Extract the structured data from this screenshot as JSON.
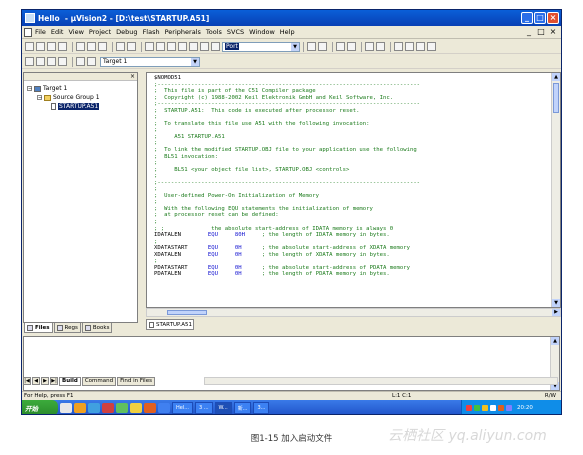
{
  "window": {
    "title": "Hello  - µVision2 - [D:\\test\\STARTUP.A51]",
    "buttons": {
      "minimize": "_",
      "maximize": "□",
      "close": "×"
    }
  },
  "menu": {
    "items": [
      "File",
      "Edit",
      "View",
      "Project",
      "Debug",
      "Flash",
      "Peripherals",
      "Tools",
      "SVCS",
      "Window",
      "Help"
    ],
    "mdi_buttons": [
      "_",
      "□",
      "×"
    ]
  },
  "toolbar1": {
    "find_value": "Port"
  },
  "toolbar2": {
    "target_combo": "Target 1"
  },
  "project": {
    "tree": {
      "target": "Target 1",
      "group": "Source Group 1",
      "file": "STARTUP.A51"
    },
    "tabs": [
      "Files",
      "Regs",
      "Books"
    ]
  },
  "editor": {
    "tab": "STARTUP.A51",
    "lines": [
      {
        "t": "$NOMOD51",
        "c": ""
      },
      {
        "t": ";------------------------------------------------------------------------------",
        "c": "cm"
      },
      {
        "t": ";  This file is part of the C51 Compiler package",
        "c": "cm"
      },
      {
        "t": ";  Copyright (c) 1988-2002 Keil Elektronik GmbH and Keil Software, Inc.",
        "c": "cm"
      },
      {
        "t": ";------------------------------------------------------------------------------",
        "c": "cm"
      },
      {
        "t": ";  STARTUP.A51:  This code is executed after processor reset.",
        "c": "cm"
      },
      {
        "t": ";",
        "c": "cm"
      },
      {
        "t": ";  To translate this file use A51 with the following invocation:",
        "c": "cm"
      },
      {
        "t": ";",
        "c": "cm"
      },
      {
        "t": ";     A51 STARTUP.A51",
        "c": "cm"
      },
      {
        "t": ";",
        "c": "cm"
      },
      {
        "t": ";  To link the modified STARTUP.OBJ file to your application use the following",
        "c": "cm"
      },
      {
        "t": ";  BL51 invocation:",
        "c": "cm"
      },
      {
        "t": ";",
        "c": "cm"
      },
      {
        "t": ";     BL51 <your object file list>, STARTUP.OBJ <controls>",
        "c": "cm"
      },
      {
        "t": ";",
        "c": "cm"
      },
      {
        "t": ";------------------------------------------------------------------------------",
        "c": "cm"
      },
      {
        "t": ";",
        "c": "cm"
      },
      {
        "t": ";  User-defined Power-On Initialization of Memory",
        "c": "cm"
      },
      {
        "t": ";",
        "c": "cm"
      },
      {
        "t": ";  With the following EQU statements the initialization of memory",
        "c": "cm"
      },
      {
        "t": ";  at processor reset can be defined:",
        "c": "cm"
      },
      {
        "t": ";",
        "c": "cm"
      },
      {
        "t": "; ;              the absolute start-address of IDATA memory is always 0",
        "c": "cm"
      },
      {
        "t": "IDATALEN        EQU     80H     ; the length of IDATA memory in bytes.",
        "c": "eq"
      },
      {
        "t": ";",
        "c": "cm"
      },
      {
        "t": "XDATASTART      EQU     0H      ; the absolute start-address of XDATA memory",
        "c": "eq"
      },
      {
        "t": "XDATALEN        EQU     0H      ; the length of XDATA memory in bytes.",
        "c": "eq"
      },
      {
        "t": ";",
        "c": "cm"
      },
      {
        "t": "PDATASTART      EQU     0H      ; the absolute start-address of PDATA memory",
        "c": "eq"
      },
      {
        "t": "PDATALEN        EQU     0H      ; the length of PDATA memory in bytes.",
        "c": "eq"
      }
    ]
  },
  "output": {
    "tabs": [
      "Build",
      "Command",
      "Find in Files"
    ]
  },
  "status": {
    "help": "For Help, press F1",
    "position": "L:1 C:1",
    "mode": "R/W"
  },
  "taskbar": {
    "start": "开始",
    "windows": [
      "Hel...",
      "3 ...",
      "W...",
      "新...",
      "3..."
    ],
    "clock": "20:20"
  },
  "caption": "图1-15 加入启动文件",
  "watermark": "云栖社区 yq.aliyun.com"
}
